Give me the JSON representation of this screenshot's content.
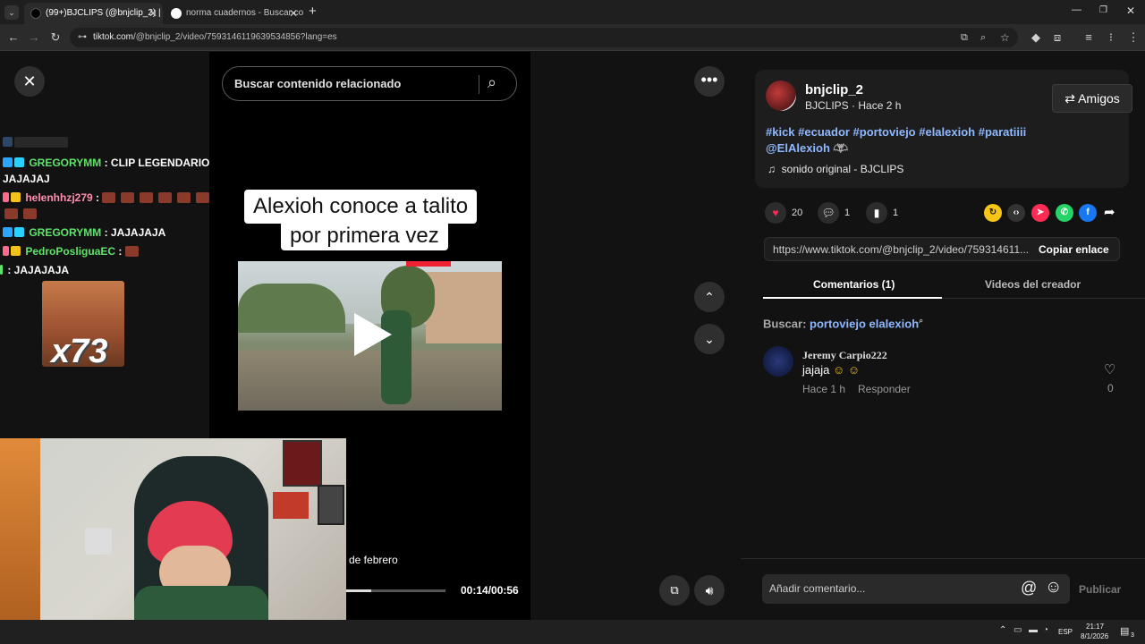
{
  "browser": {
    "tabs": [
      {
        "title": "(99+)BJCLIPS (@bnjclip_2) | Tik",
        "active": true
      },
      {
        "title": "norma cuadernos - Buscar con",
        "active": false
      }
    ],
    "url_host": "tiktok.com",
    "url_path": "/@bnjclip_2/video/7593146119639534856?lang=es"
  },
  "video": {
    "search_placeholder": "Buscar contenido relacionado",
    "caption_line1": "Alexioh conoce a talito",
    "caption_line2": "por primera vez",
    "date_text": "de febrero",
    "time_display": "00:14/00:56",
    "progress": 0.25
  },
  "chat": [
    {
      "user": "GREGORYMM",
      "text": ": CLIP LEGENDARIO",
      "cont": "JAJAJAJ",
      "color": "#5fe36a"
    },
    {
      "user": "helenhhzj279",
      "text": ":",
      "color": "#ff8fae"
    },
    {
      "user": "GREGORYMM",
      "text": ": JAJAJAJA",
      "color": "#5fe36a"
    },
    {
      "user": "PedroPosliguaEC",
      "text": ":",
      "color": "#5fe36a"
    },
    {
      "user": "",
      "text": ": JAJAJAJA",
      "color": "#5fe36a"
    }
  ],
  "emote_label": "x73",
  "author": {
    "handle": "bnjclip_2",
    "name": "BJCLIPS",
    "time": "Hace 2 h",
    "friends_label": "Amigos",
    "hashtags_line1": "#kick #ecuador #portoviejo #elalexioh #paratiiii",
    "hashtags_line2": "@ElAlexioh",
    "sound": "sonido original - BJCLIPS"
  },
  "actions": {
    "likes": "20",
    "comments": "1",
    "saves": "1"
  },
  "share_link": {
    "url": "https://www.tiktok.com/@bnjclip_2/video/759314611...",
    "copy_label": "Copiar enlace"
  },
  "tabs": {
    "comments": "Comentarios (1)",
    "creator_videos": "Videos del creador"
  },
  "search_suggestion": {
    "label": "Buscar:",
    "query": "portoviejo elalexioh"
  },
  "comment": {
    "author": "Jeremy Carpio222",
    "text": "jajaja",
    "time": "Hace 1 h",
    "reply": "Responder",
    "likes": "0"
  },
  "comment_input": {
    "placeholder": "Añadir comentario...",
    "publish": "Publicar"
  },
  "taskbar": {
    "lang": "ESP",
    "time": "21:17",
    "date": "8/1/2026",
    "notifications": "3"
  },
  "colors": {
    "like": "#fe2c55",
    "hashtag": "#8fb8ff"
  }
}
